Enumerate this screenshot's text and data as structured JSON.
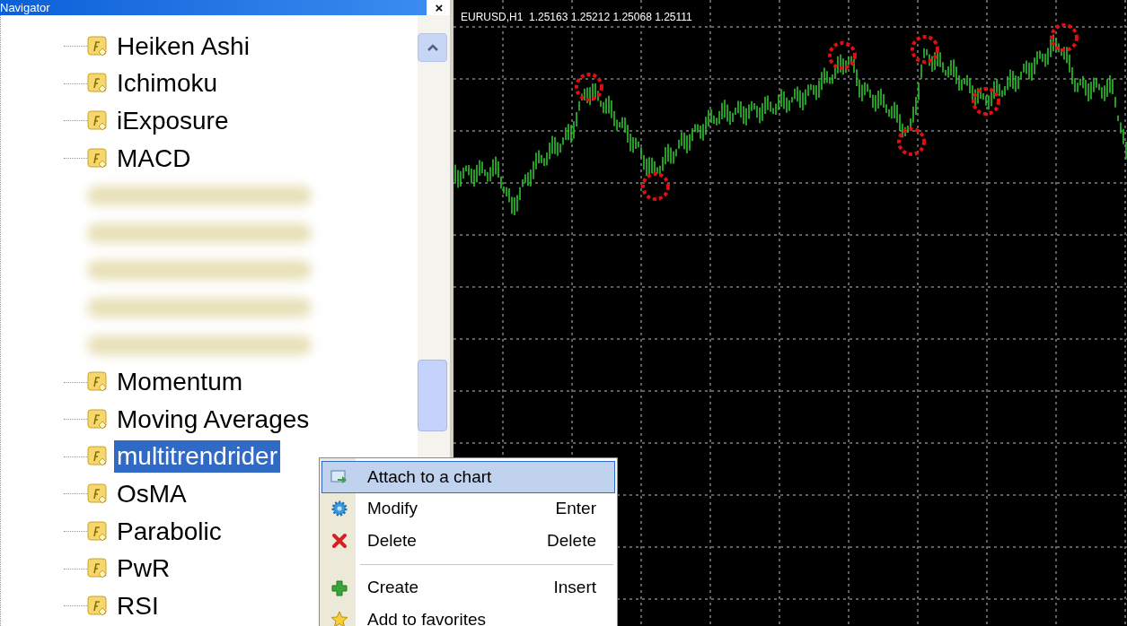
{
  "navigator": {
    "title": "Navigator",
    "close": "×",
    "items": [
      {
        "kind": "indicator",
        "label": "Heiken Ashi",
        "selected": false
      },
      {
        "kind": "indicator",
        "label": "Ichimoku",
        "selected": false
      },
      {
        "kind": "indicator",
        "label": "iExposure",
        "selected": false
      },
      {
        "kind": "indicator",
        "label": "MACD",
        "selected": false
      },
      {
        "kind": "blurred"
      },
      {
        "kind": "blurred"
      },
      {
        "kind": "blurred"
      },
      {
        "kind": "blurred"
      },
      {
        "kind": "blurred"
      },
      {
        "kind": "indicator",
        "label": "Momentum",
        "selected": false
      },
      {
        "kind": "indicator",
        "label": "Moving Averages",
        "selected": false
      },
      {
        "kind": "indicator",
        "label": "multitrendrider",
        "selected": true
      },
      {
        "kind": "indicator",
        "label": "OsMA",
        "selected": false
      },
      {
        "kind": "indicator",
        "label": "Parabolic",
        "selected": false
      },
      {
        "kind": "indicator",
        "label": "PwR",
        "selected": false
      },
      {
        "kind": "indicator",
        "label": "RSI",
        "selected": false
      }
    ]
  },
  "chart": {
    "header": "EURUSD,H1  1.25163 1.25212 1.25068 1.25111"
  },
  "context_menu": {
    "items": [
      {
        "kind": "item",
        "label": "Attach to a chart",
        "selected": true
      },
      {
        "kind": "item",
        "label": "Modify",
        "shortcut": "Enter",
        "selected": false
      },
      {
        "kind": "item",
        "label": "Delete",
        "shortcut": "Delete",
        "selected": false
      },
      {
        "kind": "separator"
      },
      {
        "kind": "item",
        "label": "Create",
        "shortcut": "Insert",
        "selected": false
      },
      {
        "kind": "item",
        "label": "Add to favorites",
        "selected": false
      }
    ]
  }
}
